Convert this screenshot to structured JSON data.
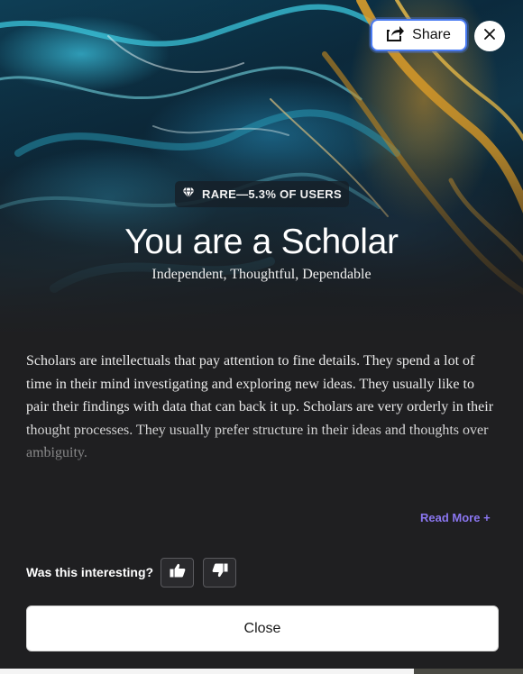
{
  "header": {
    "share_label": "Share",
    "share_icon": "share-arrow-icon",
    "close_icon": "close-icon"
  },
  "hero": {
    "rarity_label": "RARE—5.3% OF USERS",
    "rarity_icon": "diamond-icon",
    "title": "You are a Scholar",
    "subtitle": "Independent, Thoughtful, Dependable"
  },
  "body": {
    "description": "Scholars are intellectuals that pay attention to fine details. They spend a lot of time in their mind investigating and exploring new ideas. They usually like to pair their findings with data that can back it up. Scholars are very orderly in their thought processes. They usually prefer structure in their ideas and thoughts over ambiguity.",
    "read_more": "Read More +"
  },
  "feedback": {
    "question": "Was this interesting?",
    "up_icon": "thumbs-up-icon",
    "down_icon": "thumbs-down-icon"
  },
  "footer": {
    "close_label": "Close"
  },
  "colors": {
    "accent_link": "#8a76f0",
    "focus_ring": "#4a7bf2",
    "background": "#1f1f21"
  }
}
